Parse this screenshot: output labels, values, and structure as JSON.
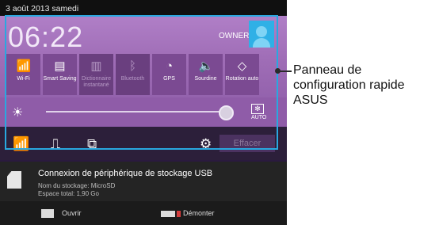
{
  "status": {
    "date": "3 août 2013 samedi"
  },
  "header": {
    "time": "06:22",
    "owner": "OWNER"
  },
  "tiles": [
    {
      "icon": "wifi-icon",
      "label": "Wi-Fi",
      "glyph": "📶",
      "enabled": true
    },
    {
      "icon": "smart-saving-icon",
      "label": "Smart Saving",
      "glyph": "▤",
      "enabled": true
    },
    {
      "icon": "dictionary-icon",
      "label": "Dictionnaire instantané",
      "glyph": "▥",
      "enabled": false
    },
    {
      "icon": "bluetooth-icon",
      "label": "Bluetooth",
      "glyph": "ᛒ",
      "enabled": false
    },
    {
      "icon": "gps-icon",
      "label": "GPS",
      "glyph": "◔",
      "enabled": true
    },
    {
      "icon": "mute-icon",
      "label": "Sourdine",
      "glyph": "🔈",
      "enabled": true
    },
    {
      "icon": "rotation-icon",
      "label": "Rotation auto",
      "glyph": "◇",
      "enabled": true
    }
  ],
  "brightness": {
    "level": 0.96,
    "auto_label": "AUTO"
  },
  "bottom_row": {
    "clear_label": "Effacer"
  },
  "notification": {
    "title": "Connexion de périphérique de stockage USB",
    "line1": "Nom du stockage: MicroSD",
    "line2": "Espace total: 1,90 Go"
  },
  "actions": {
    "open": "Ouvrir",
    "unmount": "Démonter"
  },
  "callout": {
    "text": "Panneau de configuration rapide ASUS"
  }
}
